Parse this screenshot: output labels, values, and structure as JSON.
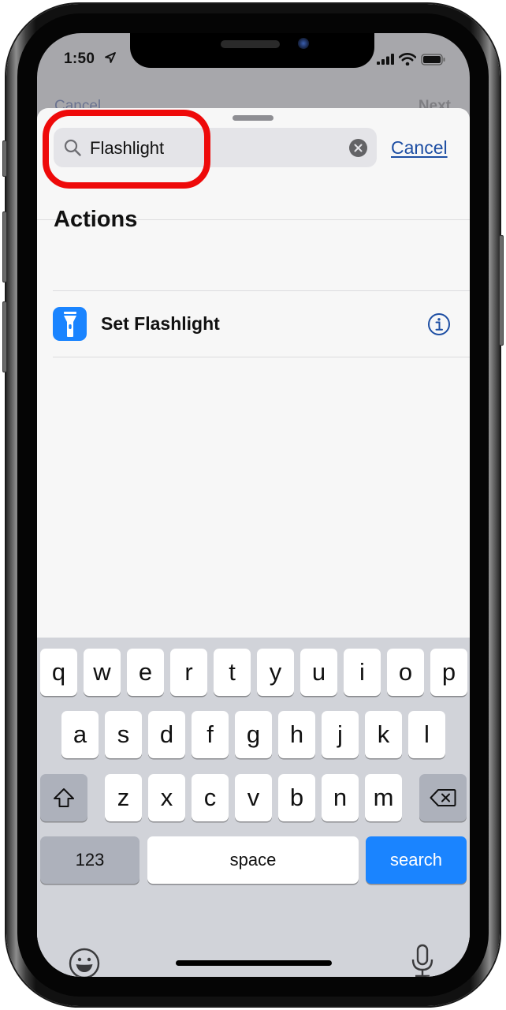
{
  "status_bar": {
    "time": "1:50",
    "location_icon": "location-arrow-icon",
    "signal_icon": "cellular-signal-icon",
    "wifi_icon": "wifi-icon",
    "battery_icon": "battery-icon"
  },
  "background_nav": {
    "left_label": "Cancel",
    "right_label": "Next"
  },
  "search": {
    "value": "Flashlight",
    "placeholder": "Search",
    "search_icon": "magnifying-glass-icon",
    "clear_icon": "clear-x-icon",
    "cancel_label": "Cancel"
  },
  "annotation": {
    "highlight_color": "#ee0a0a",
    "target": "search-field"
  },
  "results": {
    "section_title": "Actions",
    "items": [
      {
        "label": "Set Flashlight",
        "icon": "flashlight-icon",
        "icon_color": "#1a84ff",
        "accessory_icon": "info-icon"
      }
    ]
  },
  "keyboard": {
    "row1": [
      "q",
      "w",
      "e",
      "r",
      "t",
      "y",
      "u",
      "i",
      "o",
      "p"
    ],
    "row2": [
      "a",
      "s",
      "d",
      "f",
      "g",
      "h",
      "j",
      "k",
      "l"
    ],
    "row3": [
      "z",
      "x",
      "c",
      "v",
      "b",
      "n",
      "m"
    ],
    "shift_icon": "shift-arrow-icon",
    "delete_icon": "backspace-icon",
    "numbers_label": "123",
    "space_label": "space",
    "return_label": "search",
    "return_color": "#1a84ff",
    "emoji_icon": "emoji-smiley-icon",
    "dictation_icon": "microphone-icon"
  }
}
